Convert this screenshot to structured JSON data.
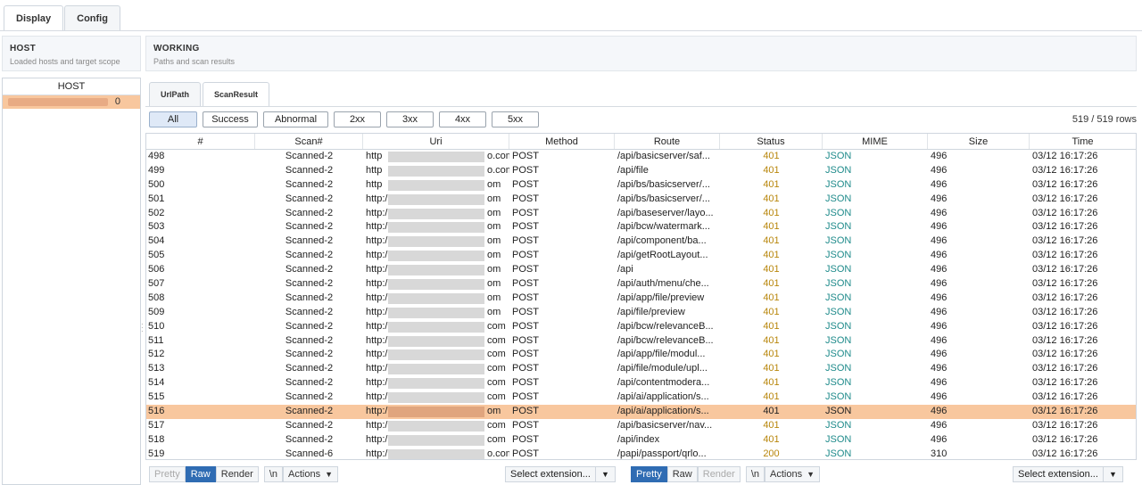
{
  "top_tabs": [
    "Display",
    "Config"
  ],
  "left_panel": {
    "title": "HOST",
    "subtitle": "Loaded hosts and target scope",
    "list_header": "HOST",
    "selected_host_tail": "0"
  },
  "right_panel": {
    "title": "WORKING",
    "subtitle": "Paths and scan results"
  },
  "sub_tabs": [
    "UrlPath",
    "ScanResult"
  ],
  "filters": [
    "All",
    "Success",
    "Abnormal",
    "2xx",
    "3xx",
    "4xx",
    "5xx"
  ],
  "row_count": "519 / 519 rows",
  "table": {
    "columns": [
      "#",
      "Scan#",
      "Uri",
      "Method",
      "Route",
      "Status",
      "MIME",
      "Size",
      "Time"
    ],
    "rows": [
      {
        "id": "498",
        "scan": "Scanned-2",
        "uri_start": "http",
        "uri_end": "o.com",
        "method": "POST",
        "route": "/api/basicserver/saf...",
        "status": "401",
        "mime": "JSON",
        "size": "496",
        "time": "03/12 16:17:26"
      },
      {
        "id": "499",
        "scan": "Scanned-2",
        "uri_start": "http",
        "uri_end": "o.com",
        "method": "POST",
        "route": "/api/file",
        "status": "401",
        "mime": "JSON",
        "size": "496",
        "time": "03/12 16:17:26"
      },
      {
        "id": "500",
        "scan": "Scanned-2",
        "uri_start": "http",
        "uri_end": "om",
        "method": "POST",
        "route": "/api/bs/basicserver/...",
        "status": "401",
        "mime": "JSON",
        "size": "496",
        "time": "03/12 16:17:26"
      },
      {
        "id": "501",
        "scan": "Scanned-2",
        "uri_start": "http:/",
        "uri_end": "om",
        "method": "POST",
        "route": "/api/bs/basicserver/...",
        "status": "401",
        "mime": "JSON",
        "size": "496",
        "time": "03/12 16:17:26"
      },
      {
        "id": "502",
        "scan": "Scanned-2",
        "uri_start": "http:/",
        "uri_end": "om",
        "method": "POST",
        "route": "/api/baseserver/layo...",
        "status": "401",
        "mime": "JSON",
        "size": "496",
        "time": "03/12 16:17:26"
      },
      {
        "id": "503",
        "scan": "Scanned-2",
        "uri_start": "http:/",
        "uri_end": "om",
        "method": "POST",
        "route": "/api/bcw/watermark...",
        "status": "401",
        "mime": "JSON",
        "size": "496",
        "time": "03/12 16:17:26"
      },
      {
        "id": "504",
        "scan": "Scanned-2",
        "uri_start": "http:/",
        "uri_end": "om",
        "method": "POST",
        "route": "/api/component/ba...",
        "status": "401",
        "mime": "JSON",
        "size": "496",
        "time": "03/12 16:17:26"
      },
      {
        "id": "505",
        "scan": "Scanned-2",
        "uri_start": "http:/",
        "uri_end": "om",
        "method": "POST",
        "route": "/api/getRootLayout...",
        "status": "401",
        "mime": "JSON",
        "size": "496",
        "time": "03/12 16:17:26"
      },
      {
        "id": "506",
        "scan": "Scanned-2",
        "uri_start": "http:/",
        "uri_end": "om",
        "method": "POST",
        "route": "/api",
        "status": "401",
        "mime": "JSON",
        "size": "496",
        "time": "03/12 16:17:26"
      },
      {
        "id": "507",
        "scan": "Scanned-2",
        "uri_start": "http:/",
        "uri_end": "om",
        "method": "POST",
        "route": "/api/auth/menu/che...",
        "status": "401",
        "mime": "JSON",
        "size": "496",
        "time": "03/12 16:17:26"
      },
      {
        "id": "508",
        "scan": "Scanned-2",
        "uri_start": "http:/",
        "uri_end": "om",
        "method": "POST",
        "route": "/api/app/file/preview",
        "status": "401",
        "mime": "JSON",
        "size": "496",
        "time": "03/12 16:17:26"
      },
      {
        "id": "509",
        "scan": "Scanned-2",
        "uri_start": "http:/",
        "uri_end": "om",
        "method": "POST",
        "route": "/api/file/preview",
        "status": "401",
        "mime": "JSON",
        "size": "496",
        "time": "03/12 16:17:26"
      },
      {
        "id": "510",
        "scan": "Scanned-2",
        "uri_start": "http:/",
        "uri_end": "com",
        "method": "POST",
        "route": "/api/bcw/relevanceB...",
        "status": "401",
        "mime": "JSON",
        "size": "496",
        "time": "03/12 16:17:26"
      },
      {
        "id": "511",
        "scan": "Scanned-2",
        "uri_start": "http:/",
        "uri_end": "com",
        "method": "POST",
        "route": "/api/bcw/relevanceB...",
        "status": "401",
        "mime": "JSON",
        "size": "496",
        "time": "03/12 16:17:26"
      },
      {
        "id": "512",
        "scan": "Scanned-2",
        "uri_start": "http:/",
        "uri_end": "com",
        "method": "POST",
        "route": "/api/app/file/modul...",
        "status": "401",
        "mime": "JSON",
        "size": "496",
        "time": "03/12 16:17:26"
      },
      {
        "id": "513",
        "scan": "Scanned-2",
        "uri_start": "http:/",
        "uri_end": "com",
        "method": "POST",
        "route": "/api/file/module/upl...",
        "status": "401",
        "mime": "JSON",
        "size": "496",
        "time": "03/12 16:17:26"
      },
      {
        "id": "514",
        "scan": "Scanned-2",
        "uri_start": "http:/",
        "uri_end": "com",
        "method": "POST",
        "route": "/api/contentmodera...",
        "status": "401",
        "mime": "JSON",
        "size": "496",
        "time": "03/12 16:17:26"
      },
      {
        "id": "515",
        "scan": "Scanned-2",
        "uri_start": "http:/",
        "uri_end": "com",
        "method": "POST",
        "route": "/api/ai/application/s...",
        "status": "401",
        "mime": "JSON",
        "size": "496",
        "time": "03/12 16:17:26"
      },
      {
        "id": "516",
        "scan": "Scanned-2",
        "uri_start": "http:/",
        "uri_end": "om",
        "method": "POST",
        "route": "/api/ai/application/s...",
        "status": "401",
        "mime": "JSON",
        "size": "496",
        "time": "03/12 16:17:26",
        "selected": true
      },
      {
        "id": "517",
        "scan": "Scanned-2",
        "uri_start": "http:/",
        "uri_end": "com",
        "method": "POST",
        "route": "/api/basicserver/nav...",
        "status": "401",
        "mime": "JSON",
        "size": "496",
        "time": "03/12 16:17:26"
      },
      {
        "id": "518",
        "scan": "Scanned-2",
        "uri_start": "http:/",
        "uri_end": "com",
        "method": "POST",
        "route": "/api/index",
        "status": "401",
        "mime": "JSON",
        "size": "496",
        "time": "03/12 16:17:26"
      },
      {
        "id": "519",
        "scan": "Scanned-6",
        "uri_start": "http:/",
        "uri_end": "o.com",
        "method": "POST",
        "route": "/papi/passport/qrlo...",
        "status": "200",
        "mime": "JSON",
        "size": "310",
        "time": "03/12 16:17:26"
      }
    ]
  },
  "request_toolbar": {
    "pretty": "Pretty",
    "raw": "Raw",
    "render": "Render",
    "newline": "\\n",
    "actions": "Actions",
    "select_extension": "Select extension..."
  },
  "response_toolbar": {
    "pretty": "Pretty",
    "raw": "Raw",
    "render": "Render",
    "newline": "\\n",
    "actions": "Actions",
    "select_extension": "Select extension..."
  },
  "colors": {
    "selected_row": "#f8c79e",
    "status": "#b8860b",
    "mime": "#1f8b8b",
    "active_toggle": "#2f6cb3"
  }
}
